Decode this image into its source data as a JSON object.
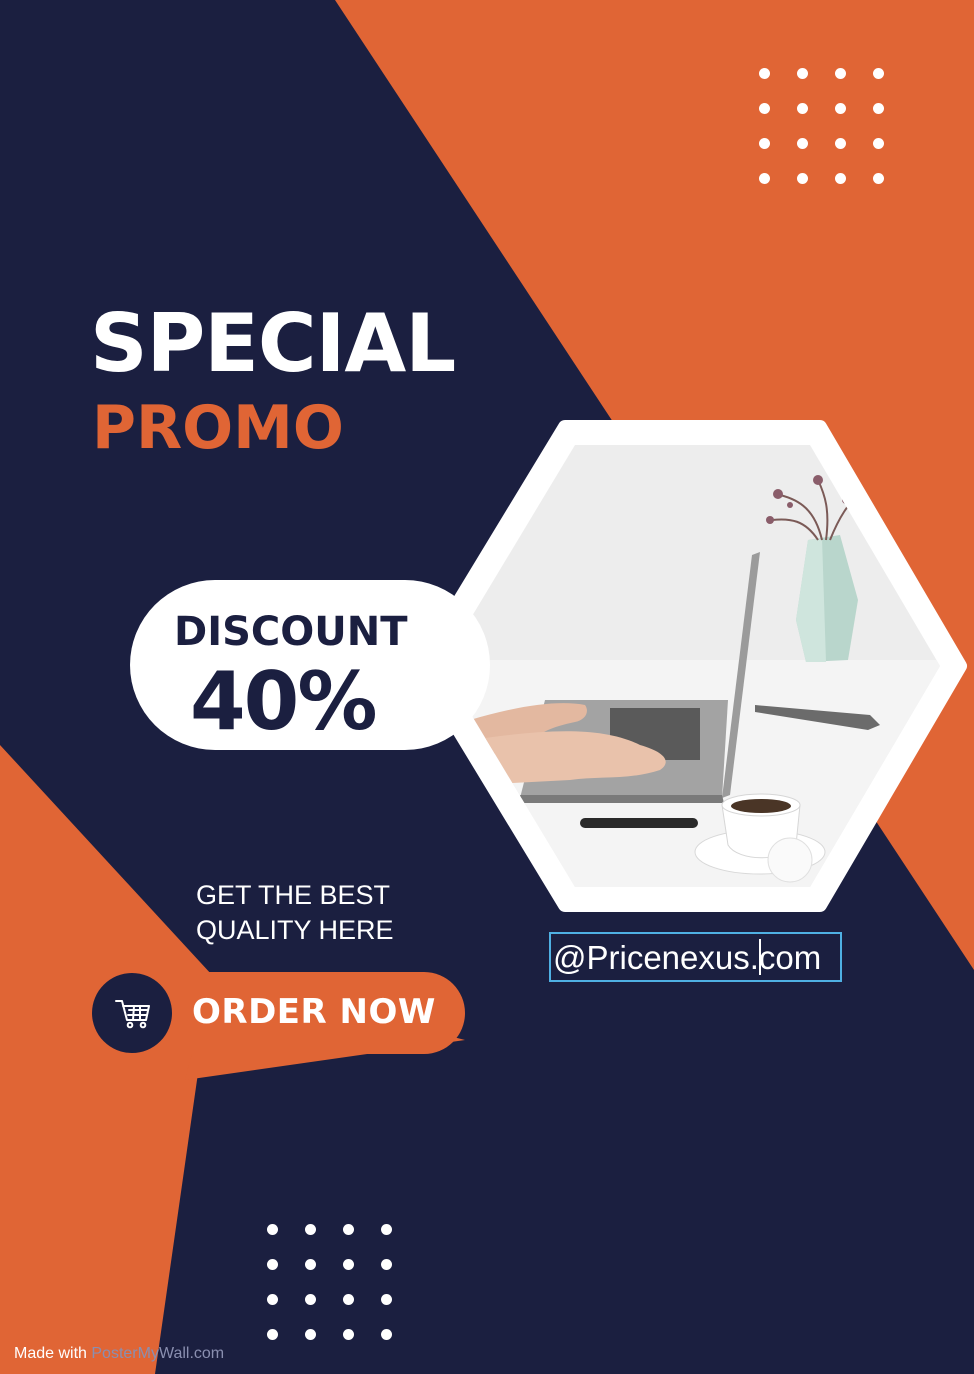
{
  "poster": {
    "title_line1": "SPECIAL",
    "title_line2": "PROMO",
    "discount_label": "DISCOUNT",
    "discount_value": "40%",
    "tagline_line1": "GET THE BEST",
    "tagline_line2": "QUALITY HERE",
    "cta_label": "ORDER NOW",
    "email_text": "@Pricenexus.com"
  },
  "footer": {
    "watermark_prefix": "Made with ",
    "watermark_brand": "PosterMyWall.com"
  },
  "icons": {
    "cart": "shopping-cart-icon"
  },
  "colors": {
    "navy": "#1b1f40",
    "orange": "#e06535",
    "white": "#ffffff",
    "text_box_outline": "#4fb0e3"
  }
}
